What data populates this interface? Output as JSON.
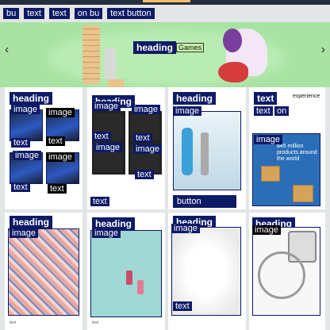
{
  "nav": {
    "items": [
      "button",
      "text",
      "button",
      "text",
      "button"
    ],
    "item_labels": [
      "bu",
      "text",
      "text",
      "on bu",
      "text button"
    ]
  },
  "hero": {
    "heading": "heading",
    "subtitle": "Games",
    "prev_arrow": "‹",
    "next_arrow": "›"
  },
  "cards": {
    "c1": {
      "heading": "heading",
      "img_labels": [
        "image",
        "image",
        "image",
        "image"
      ],
      "text_labels": [
        "text",
        "text",
        "text",
        "text"
      ]
    },
    "c2": {
      "heading": "heading",
      "img_labels": [
        "image",
        "image",
        "image",
        "image"
      ],
      "text_labels": [
        "text",
        "text",
        "text",
        "text"
      ]
    },
    "c3": {
      "heading": "heading",
      "img_label": "image",
      "button": "button"
    },
    "c4": {
      "heading": "text",
      "sub1": "experience",
      "sub2": "text",
      "sub2b": "on",
      "img_label": "image",
      "ad_text": "$45 million products around the world"
    },
    "c5": {
      "heading": "heading",
      "img_label": "image",
      "link": "text"
    },
    "c6": {
      "heading": "heading",
      "img_label": "image",
      "link": "text"
    },
    "c7": {
      "heading": "heading",
      "img_label": "image",
      "link": "text"
    },
    "c8": {
      "heading": "heading",
      "img_label": "image"
    }
  },
  "grid_text": {
    "c1_heading_side": "text",
    "c2_link": "text"
  },
  "colors": {
    "annotation_bg": "#0d1a66",
    "hero_bg": "#a9e3a4",
    "page_bg": "#e3e6e6"
  }
}
